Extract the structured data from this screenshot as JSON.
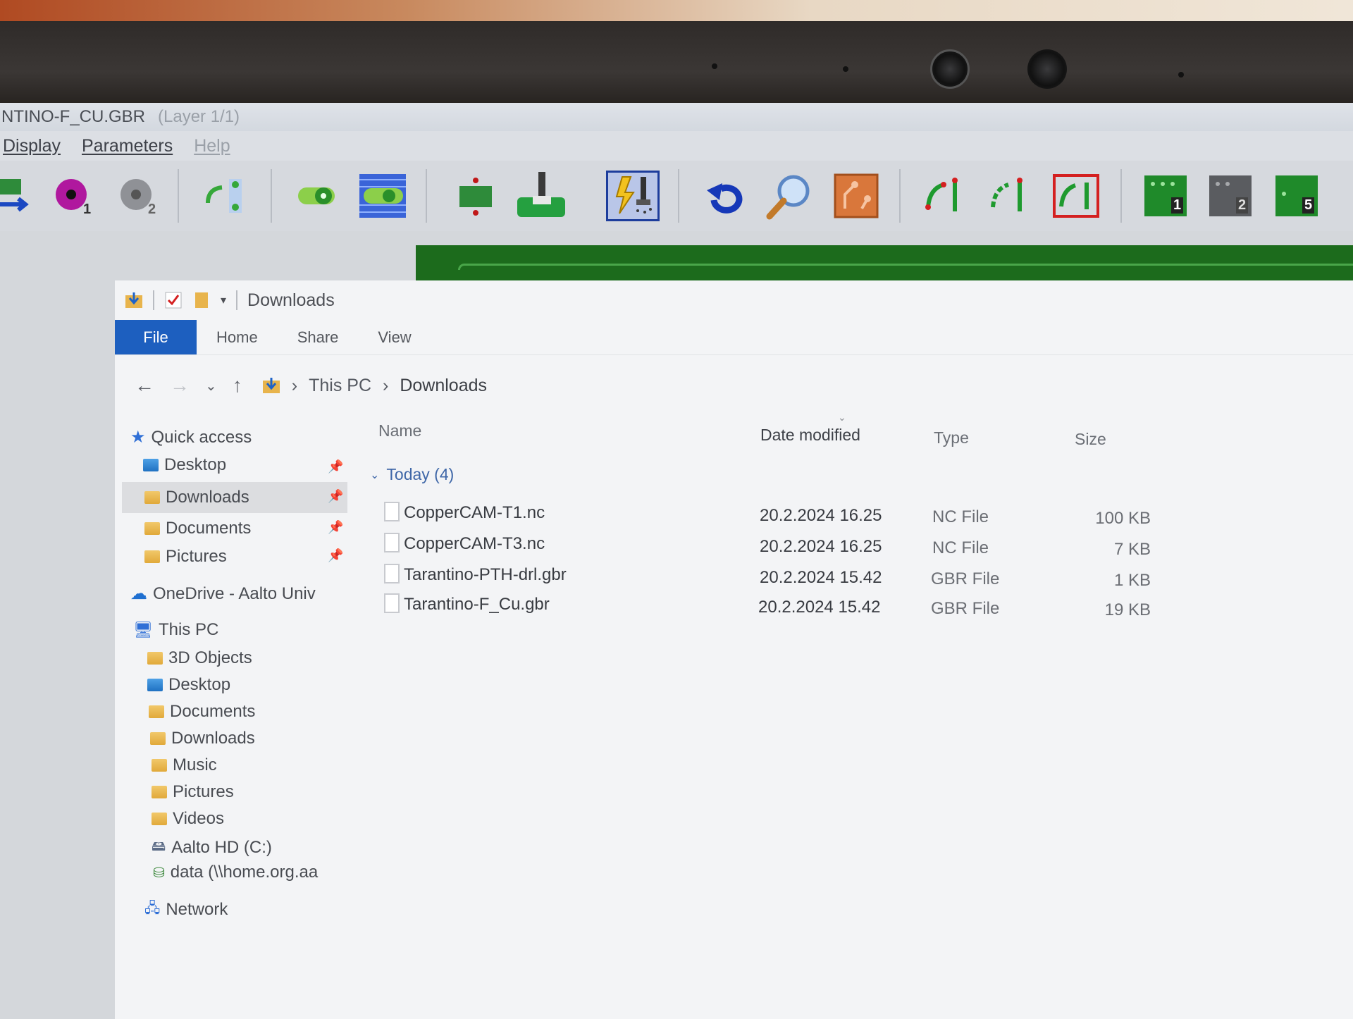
{
  "coppercam": {
    "title": "NTINO-F_CU.GBR",
    "layer": "(Layer 1/1)",
    "menu": [
      "Display",
      "Parameters",
      "Help"
    ],
    "toolbar_numbers": [
      "1",
      "2",
      "1",
      "2",
      "5"
    ]
  },
  "explorer": {
    "quick_access_title": "Downloads",
    "ribbon": [
      "File",
      "Home",
      "Share",
      "View"
    ],
    "breadcrumb": [
      "This PC",
      "Downloads"
    ],
    "nav": {
      "quick_access": "Quick access",
      "pinned": [
        "Desktop",
        "Downloads",
        "Documents",
        "Pictures"
      ],
      "onedrive": "OneDrive - Aalto Univ",
      "this_pc": "This PC",
      "pc_items": [
        "3D Objects",
        "Desktop",
        "Documents",
        "Downloads",
        "Music",
        "Pictures",
        "Videos",
        "Aalto HD (C:)",
        "data (\\\\home.org.aa"
      ],
      "network": "Network"
    },
    "columns": [
      "Name",
      "Date modified",
      "Type",
      "Size"
    ],
    "group": "Today (4)",
    "files": [
      {
        "name": "CopperCAM-T1.nc",
        "date": "20.2.2024 16.25",
        "type": "NC File",
        "size": "100 KB"
      },
      {
        "name": "CopperCAM-T3.nc",
        "date": "20.2.2024 16.25",
        "type": "NC File",
        "size": "7 KB"
      },
      {
        "name": "Tarantino-PTH-drl.gbr",
        "date": "20.2.2024 15.42",
        "type": "GBR File",
        "size": "1 KB"
      },
      {
        "name": "Tarantino-F_Cu.gbr",
        "date": "20.2.2024 15.42",
        "type": "GBR File",
        "size": "19 KB"
      }
    ]
  }
}
